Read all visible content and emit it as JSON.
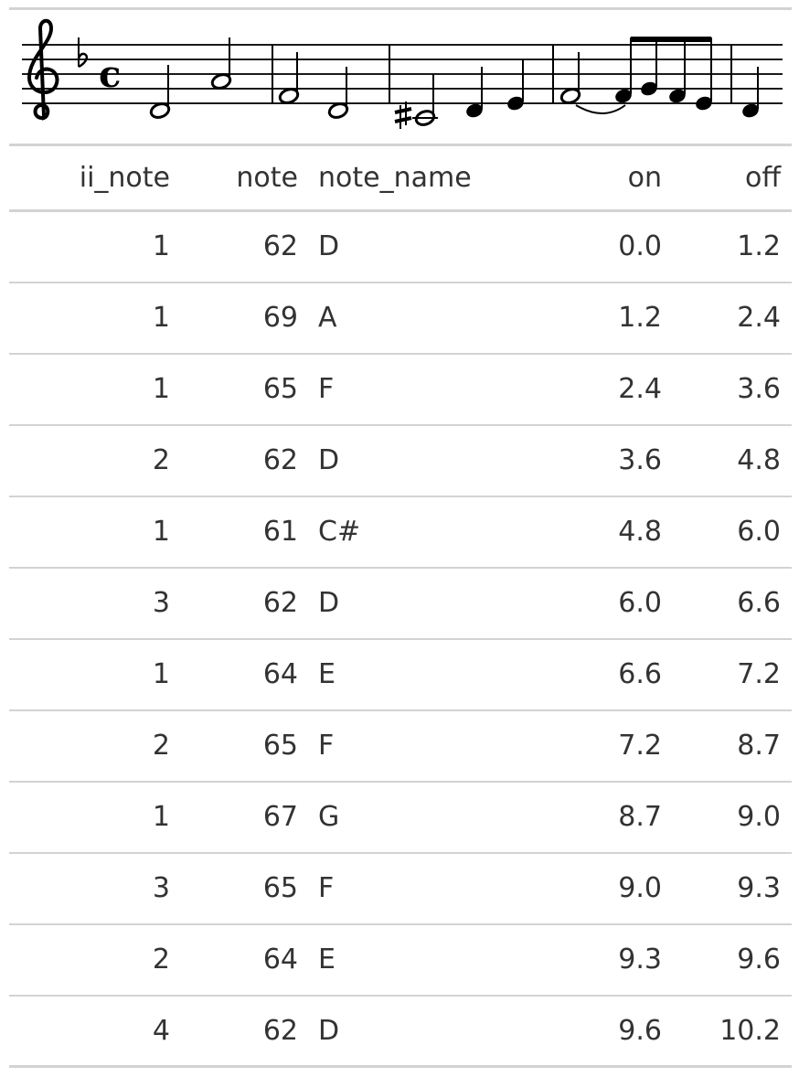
{
  "score": {
    "clef": "treble-clef",
    "key_signature": "one-flat",
    "time_signature": "common-time"
  },
  "table": {
    "columns": [
      "ii_note",
      "note",
      "note_name",
      "on",
      "off"
    ],
    "rows": [
      {
        "ii_note": "1",
        "note": "62",
        "note_name": "D",
        "on": "0.0",
        "off": "1.2"
      },
      {
        "ii_note": "1",
        "note": "69",
        "note_name": "A",
        "on": "1.2",
        "off": "2.4"
      },
      {
        "ii_note": "1",
        "note": "65",
        "note_name": "F",
        "on": "2.4",
        "off": "3.6"
      },
      {
        "ii_note": "2",
        "note": "62",
        "note_name": "D",
        "on": "3.6",
        "off": "4.8"
      },
      {
        "ii_note": "1",
        "note": "61",
        "note_name": "C#",
        "on": "4.8",
        "off": "6.0"
      },
      {
        "ii_note": "3",
        "note": "62",
        "note_name": "D",
        "on": "6.0",
        "off": "6.6"
      },
      {
        "ii_note": "1",
        "note": "64",
        "note_name": "E",
        "on": "6.6",
        "off": "7.2"
      },
      {
        "ii_note": "2",
        "note": "65",
        "note_name": "F",
        "on": "7.2",
        "off": "8.7"
      },
      {
        "ii_note": "1",
        "note": "67",
        "note_name": "G",
        "on": "8.7",
        "off": "9.0"
      },
      {
        "ii_note": "3",
        "note": "65",
        "note_name": "F",
        "on": "9.0",
        "off": "9.3"
      },
      {
        "ii_note": "2",
        "note": "64",
        "note_name": "E",
        "on": "9.3",
        "off": "9.6"
      },
      {
        "ii_note": "4",
        "note": "62",
        "note_name": "D",
        "on": "9.6",
        "off": "10.2"
      }
    ]
  }
}
